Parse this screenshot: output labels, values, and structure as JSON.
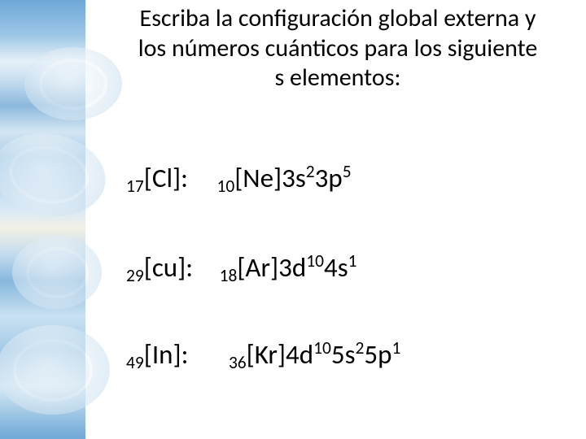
{
  "title": "Escriba la configuración global externa y los números cuánticos para los siguiente s elementos:",
  "rows": [
    {
      "label": {
        "pre": "17",
        "sym": "[Cl]:"
      },
      "config": {
        "core_pre": "10",
        "core": "[Ne]",
        "orbitals": [
          {
            "shell": "3s",
            "exp": "2"
          },
          {
            "shell": "3p",
            "exp": "5"
          }
        ]
      }
    },
    {
      "label": {
        "pre": "29",
        "sym": "[cu]:"
      },
      "config": {
        "core_pre": "18",
        "core": "[Ar]",
        "orbitals": [
          {
            "shell": "3d",
            "exp": "10"
          },
          {
            "shell": "4s",
            "exp": "1"
          }
        ]
      }
    },
    {
      "label": {
        "pre": "49",
        "sym": "[In]:"
      },
      "config": {
        "core_pre": "36",
        "core": "[Kr]",
        "orbitals": [
          {
            "shell": "4d",
            "exp": "10"
          },
          {
            "shell": "5s",
            "exp": "2"
          },
          {
            "shell": "5p",
            "exp": "1"
          }
        ]
      }
    }
  ]
}
